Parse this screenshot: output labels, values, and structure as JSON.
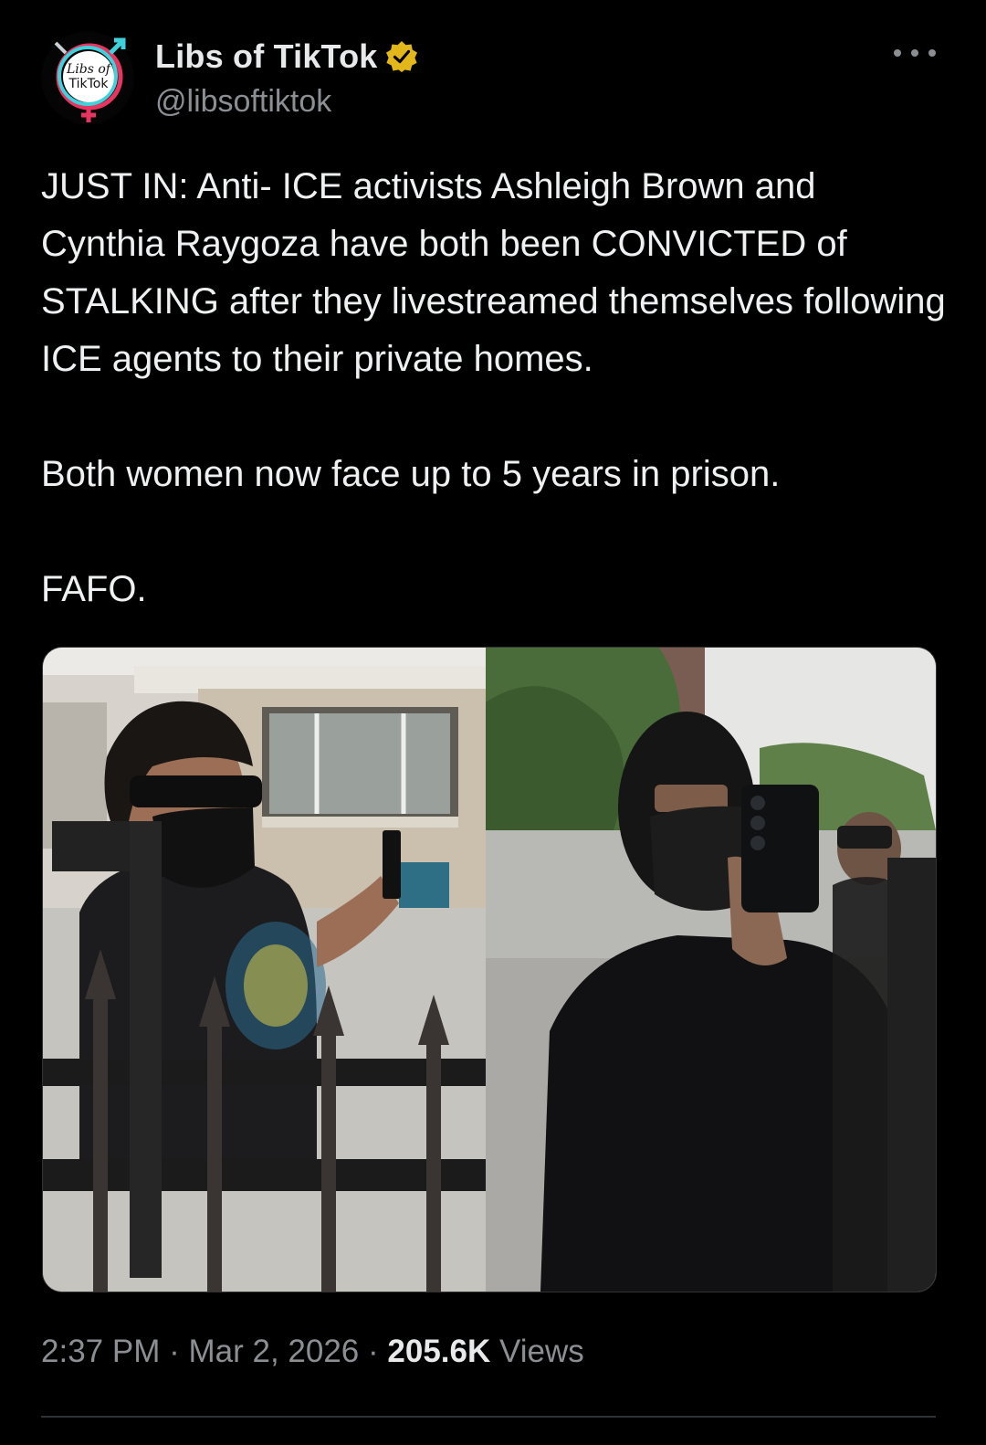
{
  "author": {
    "display_name": "Libs of TikTok",
    "handle": "@libsoftiktok",
    "verified": true,
    "verified_badge_color": "#e2b719",
    "avatar_text_line1": "Libs of",
    "avatar_text_line2": "TikTok"
  },
  "tweet": {
    "paragraphs": [
      "JUST IN: Anti- ICE activists Ashleigh Brown and Cynthia Raygoza have both been CONVICTED of STALKING after they livestreamed themselves following ICE agents to their private homes.",
      "Both women now face up to 5 years in prison.",
      "FAFO."
    ],
    "time": "2:37 PM",
    "date": "Mar 2, 2026",
    "separator": "·",
    "views_count": "205.6K",
    "views_label": "Views"
  },
  "media": {
    "photos": [
      {
        "label": "masked woman in sunglasses holding a phone behind an iron fence"
      },
      {
        "label": "person in black balaclava holding a phone near a fence"
      }
    ]
  },
  "icons": {
    "more": "more-icon",
    "verified": "verified-badge-icon",
    "avatar": "avatar-logo"
  },
  "colors": {
    "background": "#000000",
    "text": "#e7e9ea",
    "secondary_text": "#8b8f94",
    "divider": "#2f3336"
  }
}
